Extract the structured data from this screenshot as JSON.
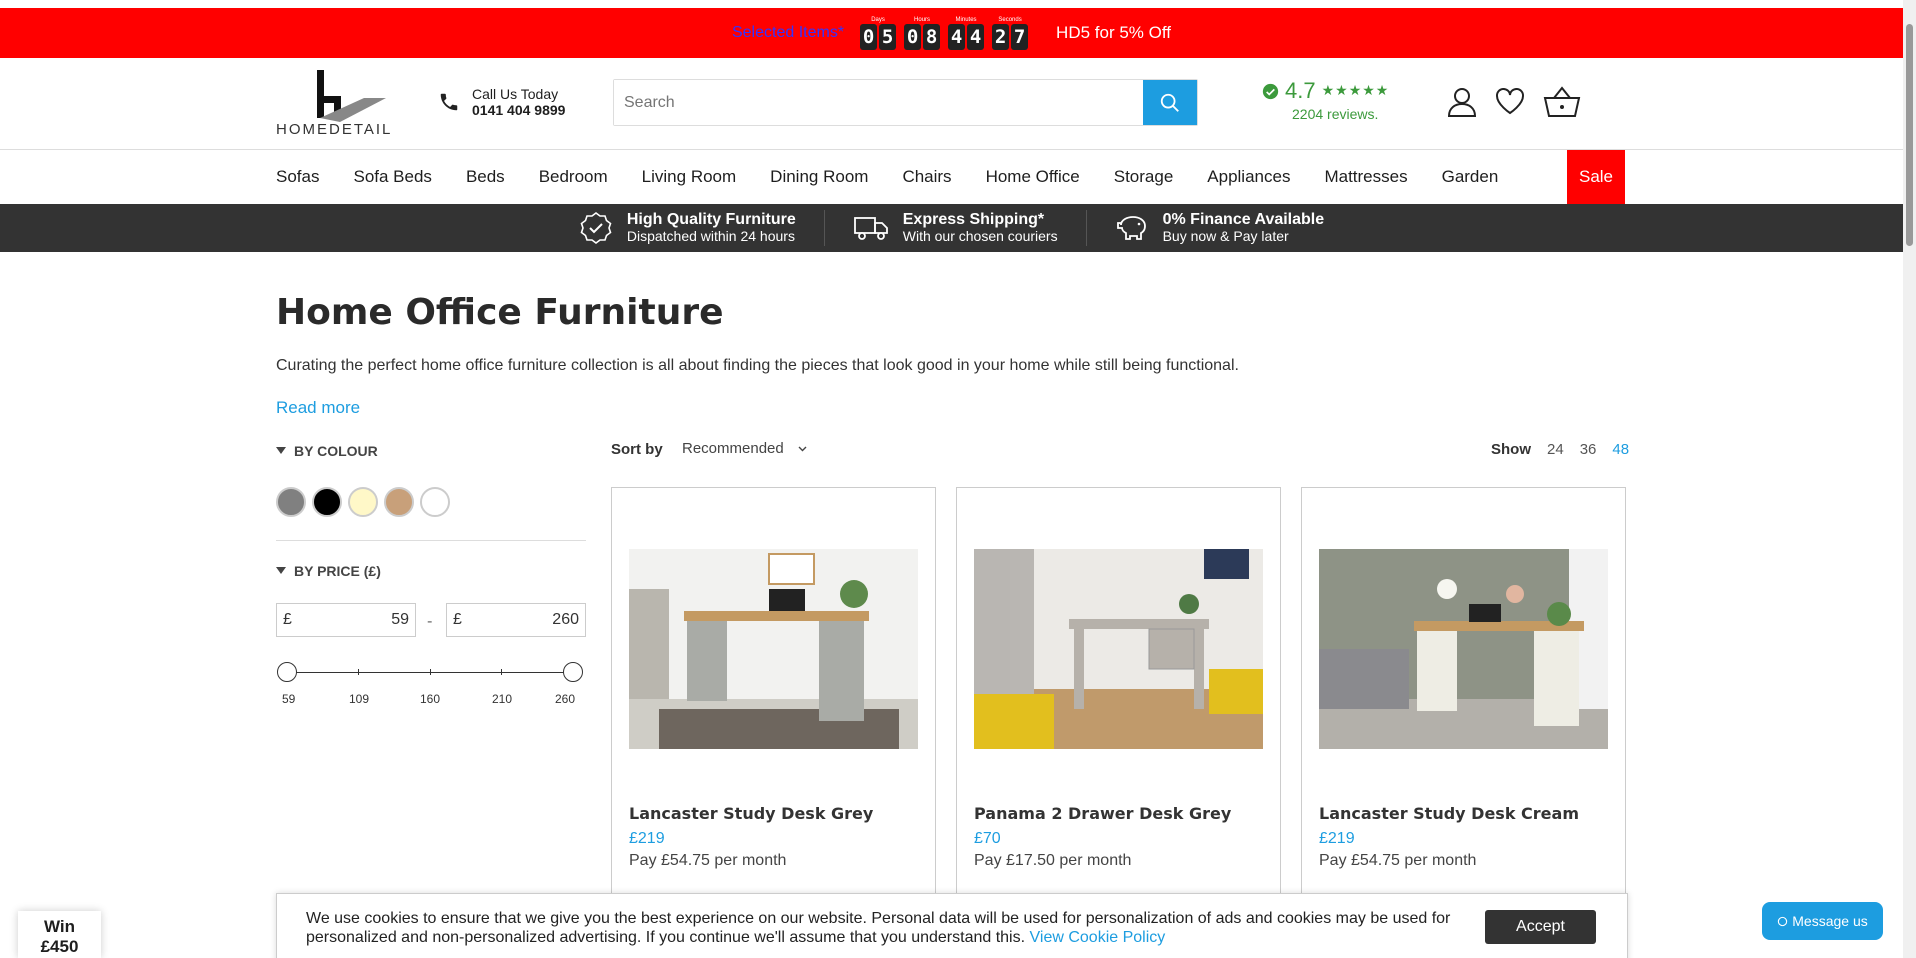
{
  "promo": {
    "selected_items": "Selected Items*",
    "countdown": [
      {
        "label": "Days",
        "digits": [
          "0",
          "5"
        ]
      },
      {
        "label": "Hours",
        "digits": [
          "0",
          "8"
        ]
      },
      {
        "label": "Minutes",
        "digits": [
          "4",
          "4"
        ]
      },
      {
        "label": "Seconds",
        "digits": [
          "2",
          "7"
        ]
      }
    ],
    "code_text": "HD5 for 5% Off",
    "bg_color": "#ff0000"
  },
  "header": {
    "logo_text": "HOMEDETAIL",
    "phone_label": "Call Us Today",
    "phone_number": "0141 404 9899",
    "search_placeholder": "Search",
    "rating_value": "4.7",
    "rating_stars": "★★★★★",
    "reviews_text": "2204 reviews.",
    "accent_color": "#1d9de0"
  },
  "nav": {
    "items": [
      "Sofas",
      "Sofa Beds",
      "Beds",
      "Bedroom",
      "Living Room",
      "Dining Room",
      "Chairs",
      "Home Office",
      "Storage",
      "Appliances",
      "Mattresses",
      "Garden"
    ],
    "sale_label": "Sale"
  },
  "usp": [
    {
      "icon": "check-badge-icon",
      "title": "High Quality Furniture",
      "subtitle": "Dispatched within 24 hours"
    },
    {
      "icon": "delivery-truck-icon",
      "title": "Express Shipping*",
      "subtitle": "With our chosen couriers"
    },
    {
      "icon": "piggy-bank-icon",
      "title": "0% Finance Available",
      "subtitle": "Buy now & Pay later"
    }
  ],
  "main": {
    "title": "Home Office Furniture",
    "intro": "Curating the perfect home office furniture collection is all about finding the pieces that look good in your home while still being functional.",
    "read_more": "Read more"
  },
  "filters": {
    "colour_heading": "BY COLOUR",
    "colours": [
      "#808080",
      "#000000",
      "#fff8c8",
      "#c8a07a",
      "#ffffff"
    ],
    "price_heading": "BY PRICE (£)",
    "currency": "£",
    "price_min": "59",
    "price_max": "260",
    "price_dash": "-",
    "slider_ticks": [
      "59",
      "109",
      "160",
      "210",
      "260"
    ]
  },
  "toolbar": {
    "sort_label": "Sort by",
    "sort_value": "Recommended",
    "show_label": "Show",
    "show_options": [
      "24",
      "36",
      "48"
    ],
    "show_active": "48"
  },
  "products": [
    {
      "name": "Lancaster Study Desk Grey",
      "price": "£219",
      "finance": "Pay £54.75 per month"
    },
    {
      "name": "Panama 2 Drawer Desk Grey",
      "price": "£70",
      "finance": "Pay £17.50 per month"
    },
    {
      "name": "Lancaster Study Desk Cream",
      "price": "£219",
      "finance": "Pay £54.75 per month"
    }
  ],
  "cookie": {
    "text": "We use cookies to ensure that we give you the best experience on our website. Personal data will be used for personalization of ads and cookies may be used for personalized and non-personalized advertising. If you continue we'll assume that you understand this.",
    "link": "View Cookie Policy",
    "accept": "Accept"
  },
  "win_badge": {
    "line1": "Win",
    "line2": "£450"
  },
  "message_us": "Message us"
}
